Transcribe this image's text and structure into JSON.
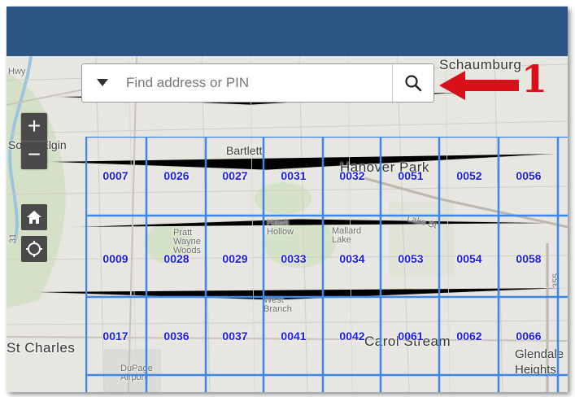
{
  "search": {
    "placeholder": "Find address or PIN"
  },
  "zoom": {
    "in_label": "+",
    "out_label": "−"
  },
  "places": {
    "schaumburg": "Schaumburg",
    "hwy": "Hwy",
    "south_elgin": "South Elgin",
    "bartlett": "Bartlett",
    "hanover_park": "Hanover Park",
    "lake_st": "Lake St",
    "hawk_hollow": "Hawk Hollow",
    "mallard_lake": "Mallard Lake",
    "pratt_wayne_woods": "Pratt Wayne Woods",
    "west_branch": "West Branch",
    "st_charles": "St Charles",
    "carol_stream": "Carol Stream",
    "glendale_heights": "Glendale Heights",
    "dupage_airport": "DuPage Airport",
    "route_355": "355",
    "route_31": "31"
  },
  "grid_cells": [
    [
      "0007",
      "0026",
      "0027",
      "0031",
      "0032",
      "0051",
      "0052",
      "0056"
    ],
    [
      "0009",
      "0028",
      "0029",
      "0033",
      "0034",
      "0053",
      "0054",
      "0058"
    ],
    [
      "0017",
      "0036",
      "0037",
      "0041",
      "0042",
      "0061",
      "0062",
      "0066"
    ]
  ],
  "annotation": {
    "number": "1"
  },
  "colors": {
    "header": "#2c5583",
    "grid_line": "#3f87e6",
    "grid_label": "#1a1ae6",
    "annotation": "#d9101a",
    "control_bg": "#4a4a4a"
  },
  "icons": {
    "zoom_in": "plus-icon",
    "zoom_out": "minus-icon",
    "home": "home-icon",
    "locate": "locate-icon",
    "dropdown": "caret-down-icon",
    "search": "magnifier-icon",
    "arrow": "arrow-left-icon"
  }
}
